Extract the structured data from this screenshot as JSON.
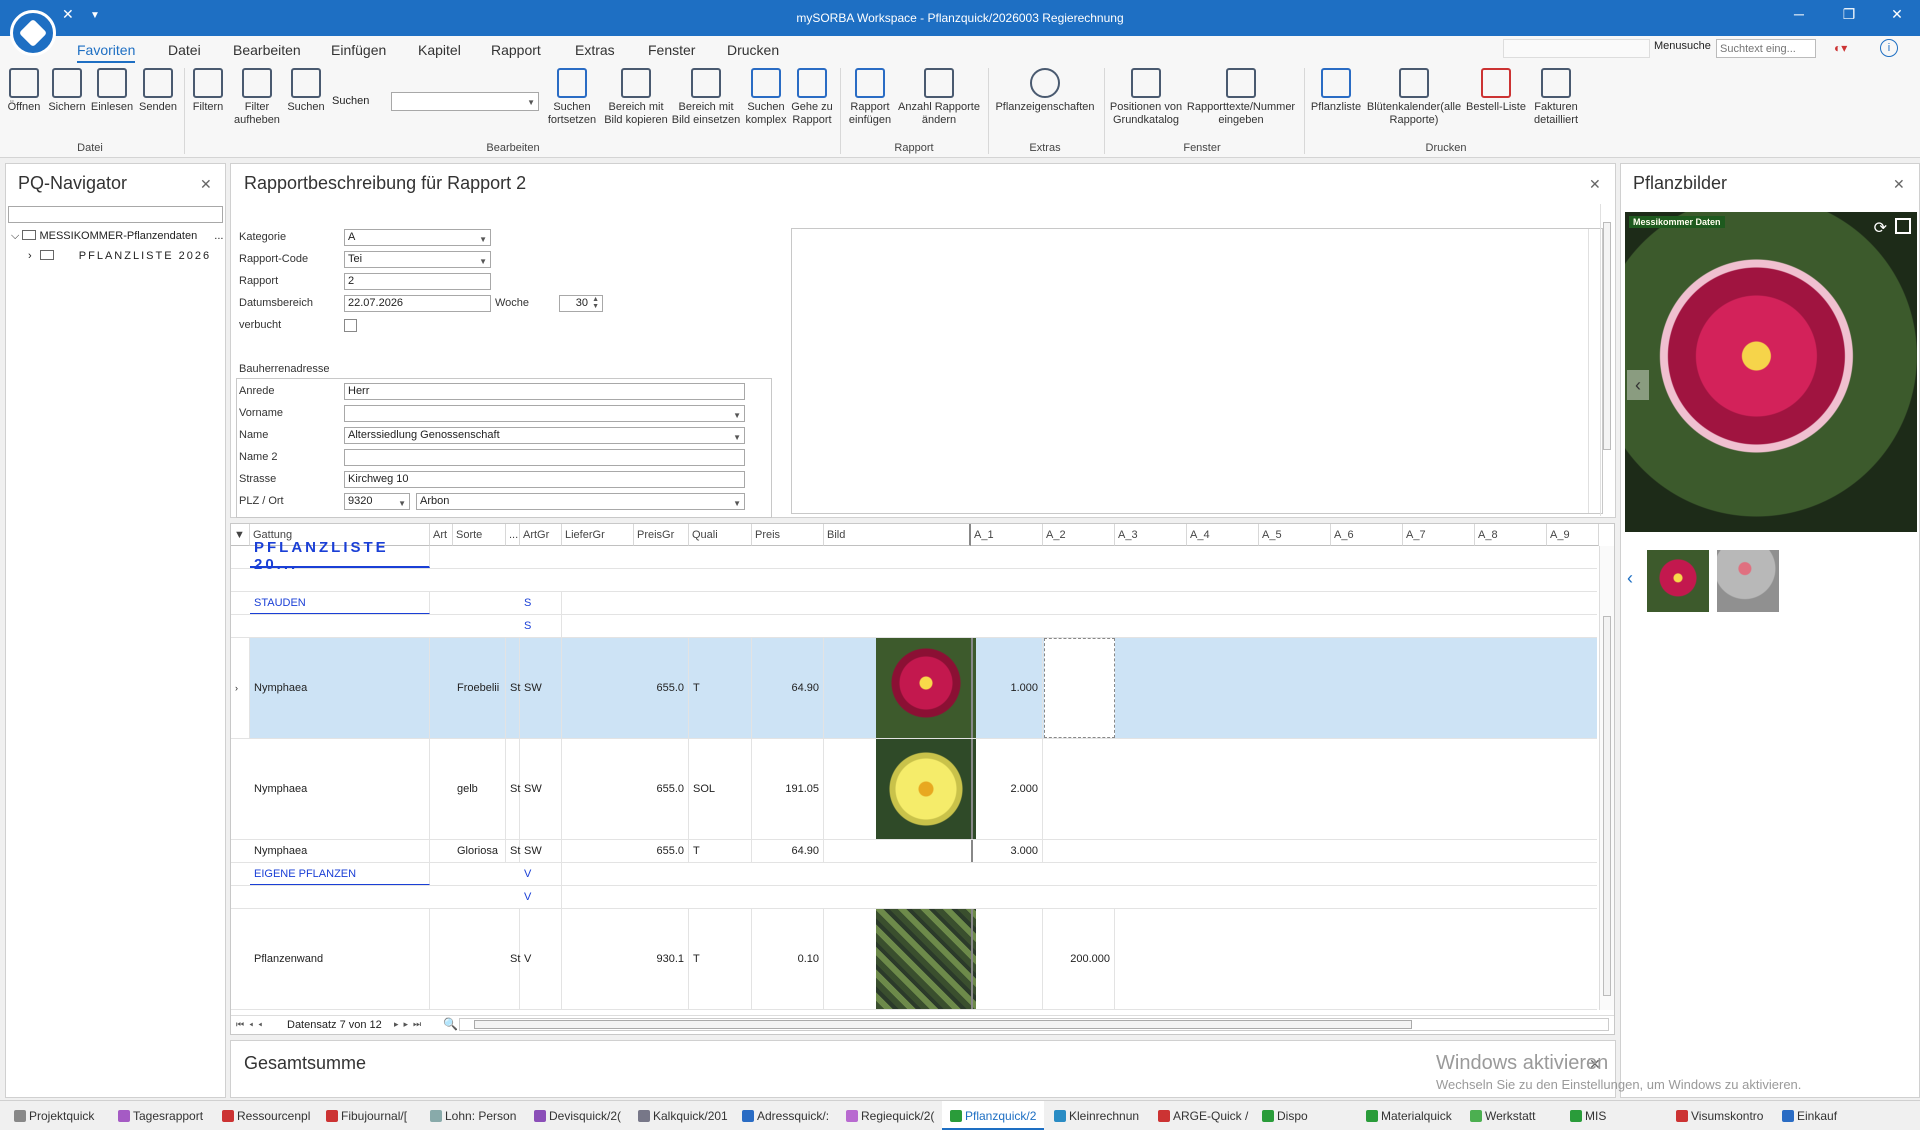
{
  "window": {
    "title": "mySORBA Workspace - Pflanzquick/2026003 Regierechnung"
  },
  "menu": {
    "tabs": [
      "Favoriten",
      "Datei",
      "Bearbeiten",
      "Einfügen",
      "Kapitel",
      "Rapport",
      "Extras",
      "Fenster",
      "Drucken"
    ],
    "search_label": "Menusuche",
    "search_placeholder": "Suchtext eing..."
  },
  "ribbon": {
    "groups": {
      "datei": "Datei",
      "bearbeiten": "Bearbeiten",
      "rapport": "Rapport",
      "extras": "Extras",
      "fenster": "Fenster",
      "drucken": "Drucken"
    },
    "buttons": {
      "oeffnen": "Öffnen",
      "sichern": "Sichern",
      "einlesen": "Einlesen",
      "senden": "Senden",
      "filtern": "Filtern",
      "filter_aufheben_1": "Filter",
      "filter_aufheben_2": "aufheben",
      "suchen": "Suchen",
      "suchen_label": "Suchen",
      "suchen_fortsetzen_1": "Suchen",
      "suchen_fortsetzen_2": "fortsetzen",
      "bereich_kopieren_1": "Bereich mit",
      "bereich_kopieren_2": "Bild kopieren",
      "bereich_einsetzen_1": "Bereich mit",
      "bereich_einsetzen_2": "Bild einsetzen",
      "suchen_komplex_1": "Suchen",
      "suchen_komplex_2": "komplex",
      "gehe_rapport_1": "Gehe zu",
      "gehe_rapport_2": "Rapport",
      "rapport_einfuegen_1": "Rapport",
      "rapport_einfuegen_2": "einfügen",
      "anzahl_1": "Anzahl Rapporte",
      "anzahl_2": "ändern",
      "pflanzeigenschaften": "Pflanzeigenschaften",
      "positionen_1": "Positionen von",
      "positionen_2": "Grundkatalog",
      "rapporttexte_1": "Rapporttexte/Nummer",
      "rapporttexte_2": "eingeben",
      "pflanzliste": "Pflanzliste",
      "bluetenkalender_1": "Blütenkalender(alle",
      "bluetenkalender_2": "Rapporte)",
      "bestell_liste": "Bestell-Liste",
      "fakturen_1": "Fakturen",
      "fakturen_2": "detailliert"
    }
  },
  "navigator": {
    "title": "PQ-Navigator",
    "root": "MESSIKOMMER-Pflanzendaten",
    "root_suffix": "...",
    "child": "PFLANZLISTE 2026"
  },
  "rapport": {
    "title": "Rapportbeschreibung für Rapport 2",
    "fields": {
      "kategorie_label": "Kategorie",
      "kategorie": "A",
      "code_label": "Rapport-Code",
      "code": "Tei",
      "rapport_label": "Rapport",
      "rapport": "2",
      "datum_label": "Datumsbereich",
      "datum": "22.07.2026",
      "woche_label": "Woche",
      "woche": "30",
      "verbucht_label": "verbucht"
    },
    "address": {
      "section": "Bauherrenadresse",
      "anrede_label": "Anrede",
      "anrede": "Herr",
      "vorname_label": "Vorname",
      "vorname": "",
      "name_label": "Name",
      "name": "Alterssiedlung Genossenschaft",
      "name2_label": "Name 2",
      "name2": "",
      "strasse_label": "Strasse",
      "strasse": "Kirchweg 10",
      "plz_label": "PLZ / Ort",
      "plz": "9320",
      "ort": "Arbon"
    }
  },
  "grid": {
    "columns": [
      "Gattung",
      "Art",
      "Sorte",
      "...",
      "ArtGr",
      "LieferGr",
      "PreisGr",
      "Quali",
      "Preis",
      "Bild",
      "A_1",
      "A_2",
      "A_3",
      "A_4",
      "A_5",
      "A_6",
      "A_7",
      "A_8",
      "A_9"
    ],
    "rows": {
      "r0": {
        "gattung": "PFLANZLISTE 20..."
      },
      "r2": {
        "gattung": "STAUDEN",
        "artgr": "S"
      },
      "r3": {
        "artgr": "S"
      },
      "r4": {
        "gattung": "Nymphaea",
        "sorte": "Froebelii",
        "dots": "St",
        "artgr": "SW",
        "preisgr": "655.0",
        "quali": "T",
        "preis": "64.90",
        "a1": "1.000"
      },
      "r5": {
        "gattung": "Nymphaea",
        "sorte": "gelb",
        "dots": "St",
        "artgr": "SW",
        "preisgr": "655.0",
        "quali": "SOL",
        "preis": "191.05",
        "a1": "2.000"
      },
      "r6": {
        "gattung": "Nymphaea",
        "sorte": "Gloriosa",
        "dots": "St",
        "artgr": "SW",
        "preisgr": "655.0",
        "quali": "T",
        "preis": "64.90",
        "a1": "3.000"
      },
      "r7": {
        "gattung": "EIGENE PFLANZEN",
        "artgr": "V"
      },
      "r8": {
        "artgr": "V"
      },
      "r9": {
        "gattung": "Pflanzenwand",
        "dots": "St",
        "artgr": "V",
        "preisgr": "930.1",
        "quali": "T",
        "preis": "0.10",
        "a2": "200.000"
      }
    },
    "footer": "Datensatz 7 von 12"
  },
  "images_panel": {
    "title": "Pflanzbilder",
    "watermark": "Messikommer Daten"
  },
  "bottom": {
    "title": "Gesamtsumme",
    "activate_1": "Windows aktivieren",
    "activate_2": "Wechseln Sie zu den Einstellungen, um Windows zu aktivieren."
  },
  "taskbar": [
    "Projektquick",
    "Tagesrapport",
    "Ressourcenpl",
    "Fibujournal/[",
    "Lohn: Person",
    "Devisquick/2(",
    "Kalkquick/201",
    "Adressquick/:",
    "Regiequick/2(",
    "Pflanzquick/2",
    "Kleinrechnun",
    "ARGE-Quick /",
    "Dispo",
    "Materialquick",
    "Werkstatt",
    "MIS",
    "Visumskontro",
    "Einkauf"
  ],
  "colors": {
    "accent": "#1e6fc3",
    "selected_row": "#cde3f5",
    "category_text": "#1a3fd6"
  }
}
